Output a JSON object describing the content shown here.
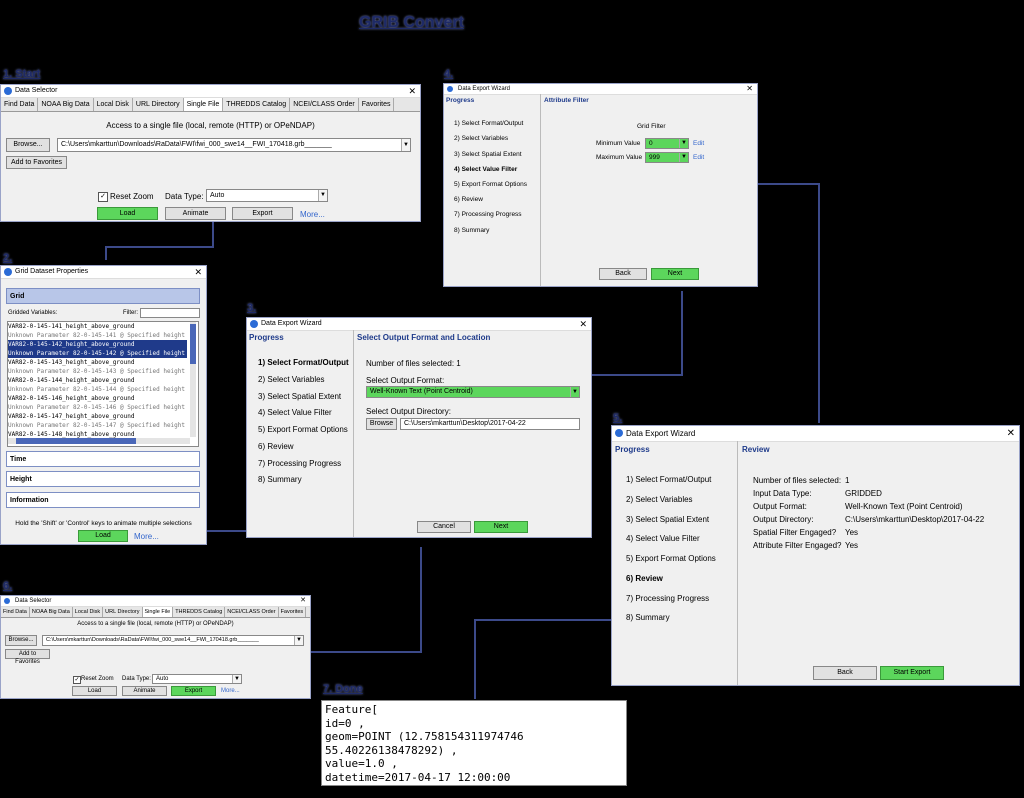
{
  "title": "GRIB Convert",
  "labels": {
    "s1": "1. Start",
    "s2": "2.",
    "s3": "3.",
    "s4": "4.",
    "s5": "5.",
    "s6": "6.",
    "s7": "7. Done"
  },
  "ds": {
    "window_title": "Data Selector",
    "tabs": [
      "Find Data",
      "NOAA Big Data",
      "Local Disk",
      "URL Directory",
      "Single File",
      "THREDDS Catalog",
      "NCEI/CLASS Order",
      "Favorites"
    ],
    "subtitle": "Access to a single file (local, remote (HTTP) or OPeNDAP)",
    "browse": "Browse...",
    "path": "C:\\Users\\mkarttun\\Downloads\\RaData\\FWI\\fwi_000_swe14__FWI_170418.grb_______",
    "favorites": "Add to Favorites",
    "reset_zoom": "Reset Zoom",
    "data_type_label": "Data Type:",
    "data_type_value": "Auto",
    "load": "Load",
    "animate": "Animate",
    "export": "Export",
    "more": "More..."
  },
  "gp": {
    "window_title": "Grid Dataset Properties",
    "grid": "Grid",
    "gridded_vars": "Gridded Variables:",
    "filter": "Filter:",
    "vars": [
      "VAR82-0-145-141_height_above_ground",
      "Unknown Parameter 82-0-145-141 @ Specified height",
      "VAR82-0-145-142_height_above_ground",
      "Unknown Parameter 82-0-145-142 @ Specified height",
      "VAR82-0-145-143_height_above_ground",
      "Unknown Parameter 82-0-145-143 @ Specified height",
      "VAR82-0-145-144_height_above_ground",
      "Unknown Parameter 82-0-145-144 @ Specified height",
      "VAR82-0-145-146_height_above_ground",
      "Unknown Parameter 82-0-145-146 @ Specified height",
      "VAR82-0-145-147_height_above_ground",
      "Unknown Parameter 82-0-145-147 @ Specified height",
      "VAR82-0-145-148_height_above_ground"
    ],
    "time": "Time",
    "height": "Height",
    "information": "Information",
    "hint": "Hold the 'Shift' or 'Control' keys to animate multiple selections",
    "load": "Load",
    "more": "More..."
  },
  "wiz": {
    "window_title": "Data Export Wizard",
    "progress": "Progress",
    "steps": [
      "1) Select Format/Output",
      "2) Select Variables",
      "3) Select Spatial Extent",
      "4) Select Value Filter",
      "5) Export Format Options",
      "6) Review",
      "7) Processing Progress",
      "8) Summary"
    ],
    "back": "Back",
    "next": "Next",
    "cancel": "Cancel",
    "start_export": "Start Export"
  },
  "w3": {
    "header": "Select Output Format and Location",
    "num_files": "Number of files selected: 1",
    "out_format_label": "Select Output Format:",
    "out_format": "Well-Known Text (Point Centroid)",
    "out_dir_label": "Select Output Directory:",
    "browse": "Browse",
    "out_dir": "C:\\Users\\mkarttun\\Desktop\\2017-04-22"
  },
  "w4": {
    "header": "Attribute Filter",
    "grid_filter": "Grid Filter",
    "min_label": "Minimum Value",
    "min_value": "0",
    "max_label": "Maximum Value",
    "max_value": "999",
    "edit": "Edit"
  },
  "w5": {
    "header": "Review",
    "rows": [
      {
        "k": "Number of files selected:",
        "v": "1"
      },
      {
        "k": "Input Data Type:",
        "v": "GRIDDED"
      },
      {
        "k": "Output Format:",
        "v": "Well-Known Text (Point Centroid)"
      },
      {
        "k": "Output Directory:",
        "v": "C:\\Users\\mkarttun\\Desktop\\2017-04-22"
      },
      {
        "k": "Spatial Filter Engaged?",
        "v": "Yes"
      },
      {
        "k": "Attribute Filter Engaged?",
        "v": "Yes"
      }
    ]
  },
  "done": {
    "lines": [
      "Feature[",
      "id=0 ,",
      "geom=POINT (12.758154311974746 55.40226138478292) ,",
      "value=1.0 ,",
      "datetime=2017-04-17 12:00:00",
      "]"
    ]
  },
  "colors": {
    "accent_green": "#5cd65c",
    "selection_blue": "#1f3a8a",
    "connector": "#3c4a8a"
  }
}
